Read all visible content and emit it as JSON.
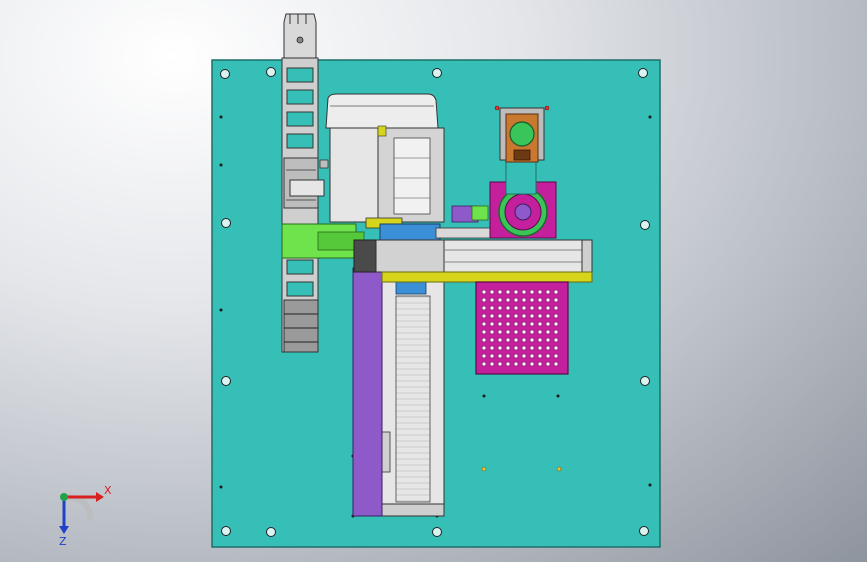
{
  "viewport": {
    "background_colors": [
      "#ffffff",
      "#e4e6ea",
      "#b7bcc4",
      "#8e949d"
    ]
  },
  "colors": {
    "base_plate": "#36bfb6",
    "plate_edge": "#1e6f6a",
    "cable_chain": "#d9d9d9",
    "linear_axis": "#e6e6e6",
    "purple_rail": "#8e59c8",
    "green_bracket": "#6fe34b",
    "yellow_beam": "#d6d51c",
    "magenta_tray": "#c41f9c",
    "orange_mount": "#c8782f",
    "green_dial": "#39c55a",
    "blue_coupler": "#3a8fd6",
    "axis_x": "#d82020",
    "axis_y": "#1fa24a",
    "axis_z": "#2040c8"
  },
  "triad": {
    "x_label": "X",
    "z_label": "Z"
  }
}
